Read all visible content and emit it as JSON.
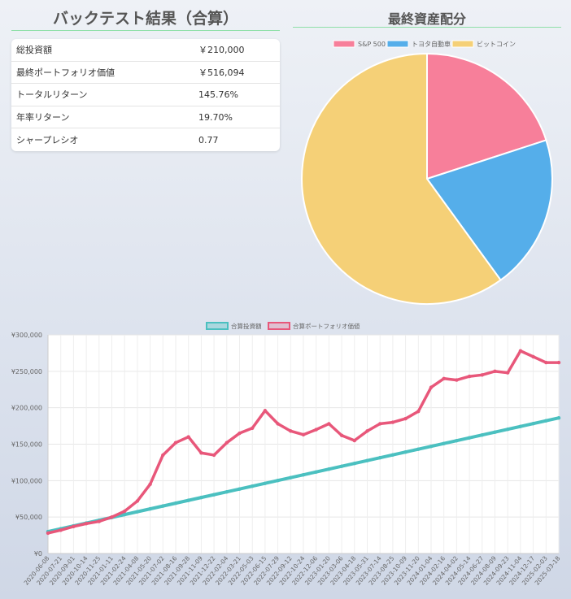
{
  "left_panel": {
    "title": "バックテスト結果（合算）",
    "metrics": [
      {
        "label": "総投資額",
        "value": "￥210,000"
      },
      {
        "label": "最終ポートフォリオ価値",
        "value": "￥516,094"
      },
      {
        "label": "トータルリターン",
        "value": "145.76%"
      },
      {
        "label": "年率リターン",
        "value": "19.70%"
      },
      {
        "label": "シャープレシオ",
        "value": "0.77"
      }
    ]
  },
  "right_panel": {
    "title": "最終資産配分"
  },
  "chart_data": [
    {
      "type": "pie",
      "title": "最終資産配分",
      "legend_position": "top",
      "labels": [
        "S&P 500",
        "トヨタ自動車",
        "ビットコイン"
      ],
      "values": [
        20,
        20,
        60
      ],
      "colors": [
        "#f77f9a",
        "#55aeea",
        "#f5d077"
      ]
    },
    {
      "type": "line",
      "legend_position": "top",
      "x": [
        "2020-06-08",
        "2020-07-21",
        "2020-09-01",
        "2020-10-14",
        "2020-11-25",
        "2021-01-11",
        "2021-02-24",
        "2021-04-08",
        "2021-05-20",
        "2021-07-02",
        "2021-08-16",
        "2021-09-28",
        "2021-11-09",
        "2021-12-22",
        "2022-02-04",
        "2022-03-21",
        "2022-05-03",
        "2022-06-15",
        "2022-07-29",
        "2022-09-12",
        "2022-10-24",
        "2022-12-06",
        "2023-01-20",
        "2023-03-06",
        "2023-04-18",
        "2023-05-31",
        "2023-07-14",
        "2023-08-25",
        "2023-10-09",
        "2023-11-20",
        "2024-01-04",
        "2024-02-16",
        "2024-04-02",
        "2024-05-14",
        "2024-06-27",
        "2024-08-09",
        "2024-09-23",
        "2024-11-04",
        "2024-12-17",
        "2025-02-03",
        "2025-03-18"
      ],
      "ylim": [
        0,
        300000
      ],
      "yticks": [
        "¥0",
        "¥50,000",
        "¥100,000",
        "¥150,000",
        "¥200,000",
        "¥250,000",
        "¥300,000"
      ],
      "grid": true,
      "series": [
        {
          "name": "合算投資額",
          "color": "#4bc0c0",
          "values": [
            30000,
            33900,
            37800,
            41700,
            45600,
            49500,
            53400,
            57300,
            61200,
            65100,
            69000,
            72900,
            76800,
            80700,
            84600,
            88500,
            92400,
            96300,
            100200,
            104100,
            108000,
            111900,
            115800,
            119700,
            123600,
            127500,
            131400,
            135300,
            139200,
            143100,
            147000,
            150900,
            154800,
            158700,
            162600,
            166500,
            170400,
            174300,
            178200,
            182100,
            186000
          ]
        },
        {
          "name": "合算ポートフォリオ価値",
          "color": "#e8577a",
          "values": [
            28000,
            32000,
            37000,
            41000,
            44000,
            50000,
            58000,
            72000,
            95000,
            135000,
            152000,
            160000,
            138000,
            135000,
            152000,
            165000,
            172000,
            196000,
            178000,
            168000,
            163000,
            170000,
            178000,
            162000,
            155000,
            168000,
            178000,
            180000,
            185000,
            195000,
            228000,
            240000,
            238000,
            243000,
            245000,
            250000,
            248000,
            278000,
            270000,
            262000,
            262000
          ]
        }
      ]
    }
  ]
}
